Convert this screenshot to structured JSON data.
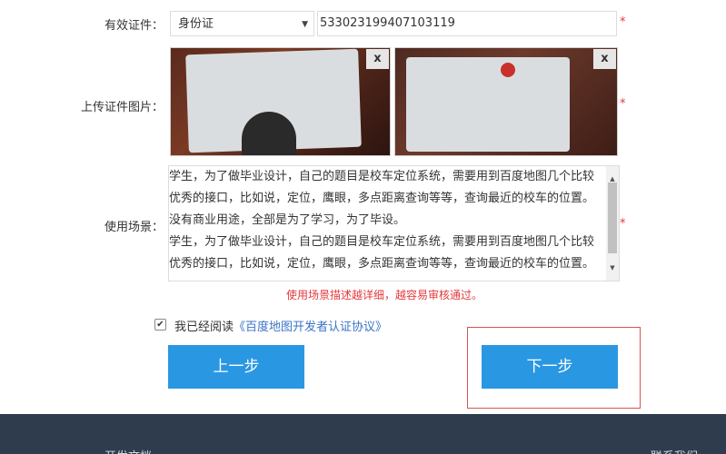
{
  "form": {
    "id_type": {
      "label": "有效证件：",
      "selected": "身份证",
      "arrow_icon": "▼",
      "required_mark": "*"
    },
    "id_number": {
      "value": "533023199407103119",
      "required_mark": "*"
    },
    "upload": {
      "label": "上传证件图片：",
      "remove_label": "x",
      "required_mark": "*"
    },
    "scenario": {
      "label": "使用场景：",
      "lines": [
        "学生，为了做毕业设计，自己的题目是校车定位系统，需要用到百度地图几个比较",
        "优秀的接口，比如说，定位，鹰眼，多点距离查询等等，查询最近的校车的位置。",
        "没有商业用途，全部是为了学习，为了毕设。",
        "学生，为了做毕业设计，自己的题目是校车定位系统，需要用到百度地图几个比较",
        "优秀的接口，比如说，定位，鹰眼，多点距离查询等等，查询最近的校车的位置。"
      ],
      "required_mark": "*",
      "hint": "使用场景描述越详细，越容易审核通过。"
    },
    "agreement": {
      "checked_mark": "✔",
      "prefix": "我已经阅读",
      "link_text": "《百度地图开发者认证协议》"
    }
  },
  "buttons": {
    "prev": "上一步",
    "next": "下一步"
  },
  "footer": {
    "left": "开发文档",
    "right": "联系我们"
  },
  "colors": {
    "primary_button": "#2a97e3",
    "required": "#e4393c",
    "footer_bg": "#2e3c4d",
    "link": "#3a73c7"
  }
}
